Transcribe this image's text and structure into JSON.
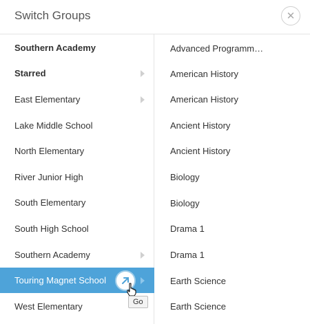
{
  "dialog": {
    "title": "Switch Groups",
    "close_icon": "close-icon"
  },
  "left_list": {
    "items": [
      {
        "label": "Southern Academy",
        "bold": true,
        "chevron": false
      },
      {
        "label": "Starred",
        "bold": true,
        "chevron": true
      },
      {
        "label": "East Elementary",
        "bold": false,
        "chevron": true
      },
      {
        "label": "Lake Middle School",
        "bold": false,
        "chevron": false
      },
      {
        "label": "North Elementary",
        "bold": false,
        "chevron": false
      },
      {
        "label": "River Junior High",
        "bold": false,
        "chevron": false
      },
      {
        "label": "South Elementary",
        "bold": false,
        "chevron": false
      },
      {
        "label": "South High School",
        "bold": false,
        "chevron": false
      },
      {
        "label": "Southern Academy",
        "bold": false,
        "chevron": true
      },
      {
        "label": "Touring Magnet School",
        "bold": false,
        "chevron": true,
        "active": true
      },
      {
        "label": "West Elementary",
        "bold": false,
        "chevron": false
      }
    ]
  },
  "right_list": {
    "items": [
      "Advanced Programm…",
      "American History",
      "American History",
      "Ancient History",
      "Ancient History",
      "Biology",
      "Biology",
      "Drama 1",
      "Drama 1",
      "Earth Science",
      "Earth Science"
    ]
  },
  "go_tooltip": "Go",
  "colors": {
    "accent": "#4ea3d9",
    "divider": "#e4e4e4"
  }
}
